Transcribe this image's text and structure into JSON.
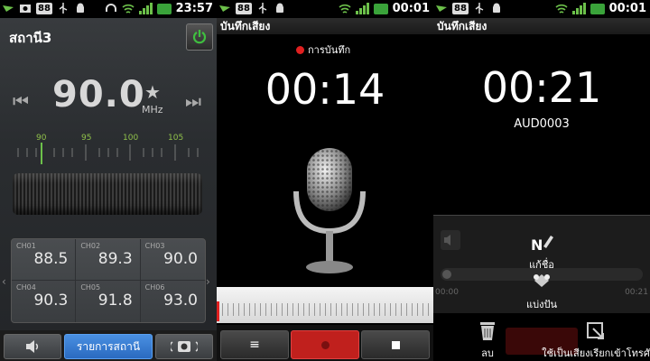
{
  "status": {
    "p1_time": "23:57",
    "p2_time": "00:01",
    "p3_time": "00:01",
    "badge": "88",
    "accent": "#6cc04a"
  },
  "radio": {
    "station": "สถานี3",
    "frequency": "90.0",
    "unit": "MHz",
    "scale": [
      "90",
      "95",
      "100",
      "105"
    ],
    "presets": [
      {
        "ch": "CH01",
        "freq": "88.5"
      },
      {
        "ch": "CH02",
        "freq": "89.3"
      },
      {
        "ch": "CH03",
        "freq": "90.0"
      },
      {
        "ch": "CH04",
        "freq": "90.3"
      },
      {
        "ch": "CH05",
        "freq": "91.8"
      },
      {
        "ch": "CH06",
        "freq": "93.0"
      }
    ],
    "list_button": "รายการสถานี"
  },
  "recorder": {
    "title": "บันทึกเสียง",
    "recording_label": "การบันทึก",
    "elapsed": "00:14",
    "record_color": "#c0201d"
  },
  "playback": {
    "title": "บันทึกเสียง",
    "elapsed": "00:21",
    "filename": "AUD0003",
    "start_time": "00:00",
    "end_time": "00:21",
    "menu": {
      "rename": "แก้ชื่อ",
      "share": "แบ่งปัน",
      "delete": "ลบ",
      "set_ringtone": "ใช้เป็นเสียงเรียกเข้าโทรศั"
    }
  }
}
